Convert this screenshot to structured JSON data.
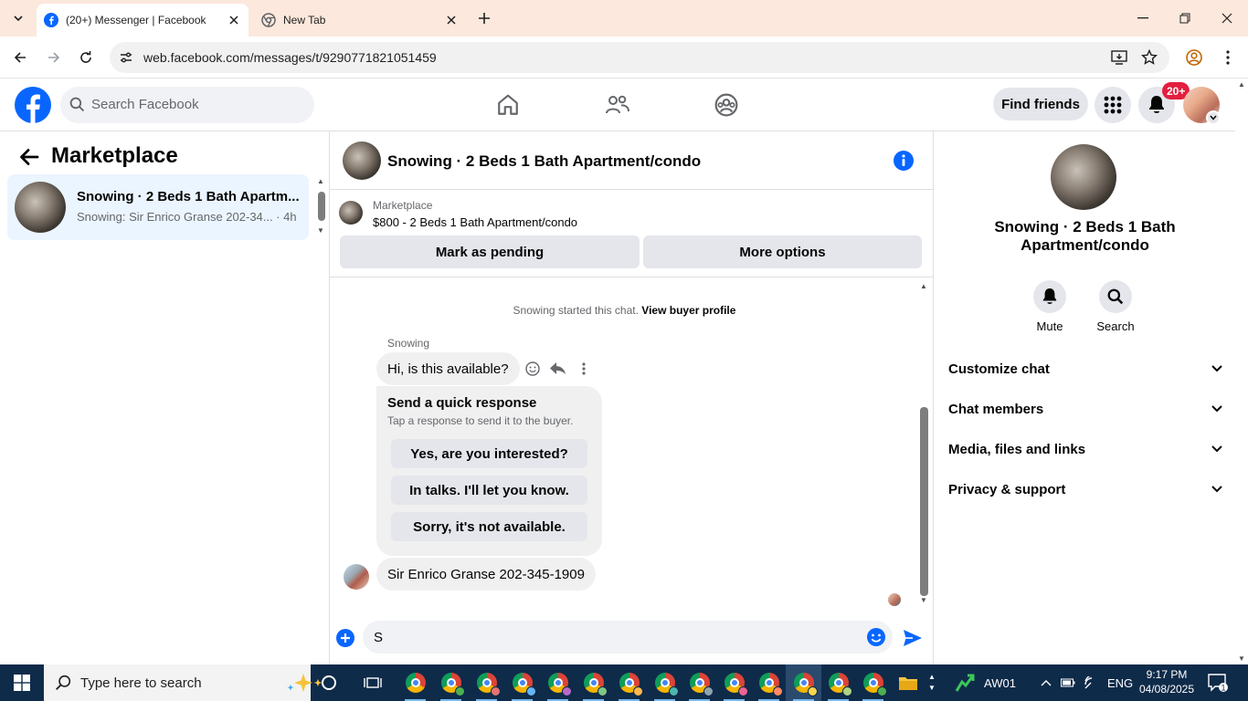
{
  "browser": {
    "tabs": [
      {
        "title": "(20+) Messenger | Facebook",
        "active": true
      },
      {
        "title": "New Tab",
        "active": false
      }
    ],
    "url": "web.facebook.com/messages/t/9290771821051459"
  },
  "fb_header": {
    "search_placeholder": "Search Facebook",
    "find_friends": "Find friends",
    "notif_badge": "20+"
  },
  "left_panel": {
    "title": "Marketplace",
    "conversations": [
      {
        "title": "Snowing · 2 Beds 1 Bath Apartm...",
        "preview": "Snowing: Sir Enrico Granse 202-34...",
        "time": "· 4h"
      }
    ]
  },
  "chat": {
    "title": "Snowing · 2 Beds 1 Bath Apartment/condo",
    "listing": {
      "category": "Marketplace",
      "price_line": "$800 - 2 Beds 1 Bath Apartment/condo",
      "btn_pending": "Mark as pending",
      "btn_more": "More options"
    },
    "started_text": "Snowing started this chat.",
    "started_link": "View buyer profile",
    "sender_name": "Snowing",
    "incoming_msg": "Hi, is this available?",
    "quick_response": {
      "title": "Send a quick response",
      "subtitle": "Tap a response to send it to the buyer.",
      "options": [
        "Yes, are you interested?",
        "In talks. I'll let you know.",
        "Sorry, it's not available."
      ]
    },
    "my_msg": "Sir Enrico Granse 202-345-1909",
    "composer_value": "S"
  },
  "right_panel": {
    "title_line1": "Snowing · 2 Beds 1 Bath",
    "title_line2": "Apartment/condo",
    "actions": [
      {
        "label": "Mute",
        "icon": "bell-icon"
      },
      {
        "label": "Search",
        "icon": "search-icon"
      }
    ],
    "sections": [
      "Customize chat",
      "Chat members",
      "Media, files and links",
      "Privacy & support"
    ]
  },
  "taskbar": {
    "search_placeholder": "Type here to search",
    "stock_ticker": "AW01",
    "lang": "ENG",
    "time": "9:17 PM",
    "date": "04/08/2025",
    "notif_count": "1"
  },
  "colors": {
    "fb_blue": "#0866ff",
    "accent": "#0084ff",
    "badge_red": "#e41e3f"
  }
}
